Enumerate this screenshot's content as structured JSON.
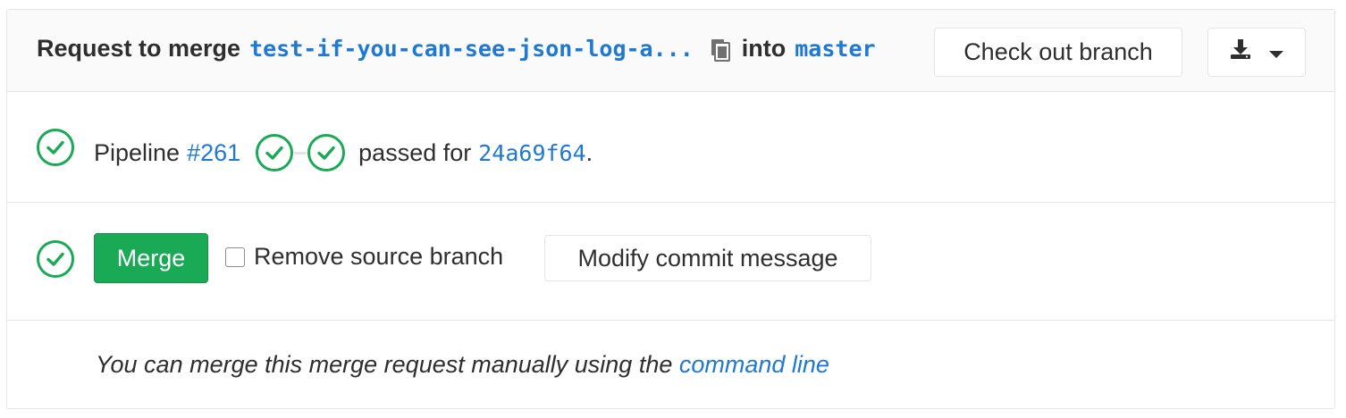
{
  "header": {
    "prefix": "Request to merge",
    "source_branch": "test-if-you-can-see-json-log-a...",
    "into_label": "into",
    "target_branch": "master",
    "checkout_label": "Check out branch"
  },
  "pipeline": {
    "label": "Pipeline",
    "id": "#261",
    "status_text": "passed for",
    "commit": "24a69f64",
    "period": ".",
    "stages": [
      "passed",
      "passed"
    ]
  },
  "merge": {
    "button_label": "Merge",
    "remove_source_label": "Remove source branch",
    "remove_source_checked": false,
    "modify_label": "Modify commit message"
  },
  "command_line": {
    "text": "You can merge this merge request manually using the",
    "link": "command line"
  },
  "colors": {
    "success": "#1aaa55",
    "link": "#1f78d1",
    "border": "#e5e5e5"
  },
  "icons": [
    "copy-icon",
    "download-icon",
    "caret-down-icon",
    "status-success-icon"
  ]
}
